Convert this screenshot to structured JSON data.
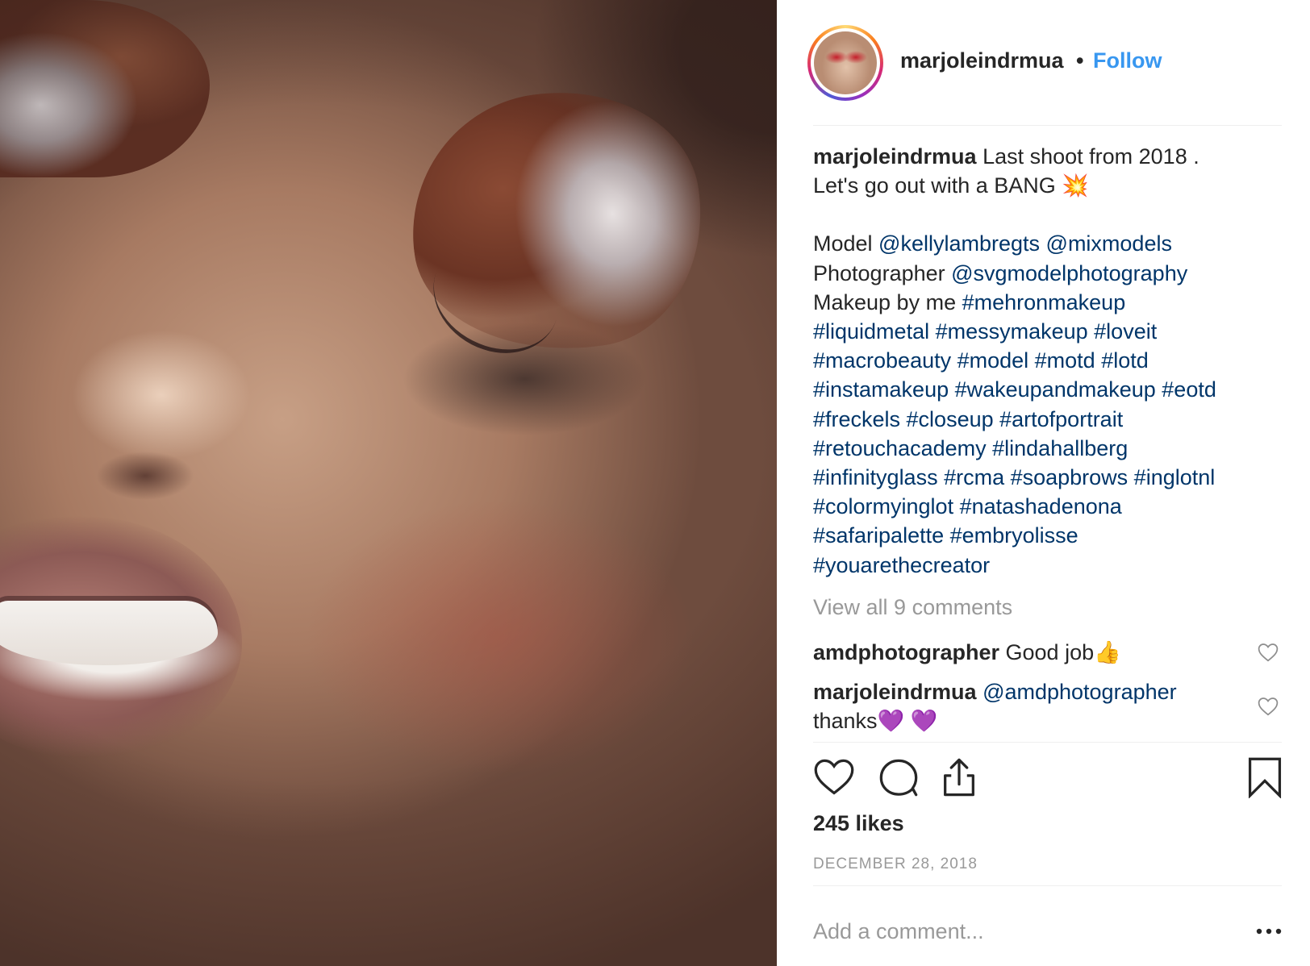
{
  "post": {
    "image_alt": "Close-up photo of a face with metallic copper and silver eyeshadow",
    "username": "marjoleindrmua",
    "separator": "•",
    "follow_label": "Follow"
  },
  "caption": {
    "username": "marjoleindrmua",
    "line1_text": " Last shoot from 2018 .",
    "line2_text": "Let's go out with a BANG 💥",
    "model_label": "Model ",
    "model_tags": [
      "@kellylambregts",
      "@mixmodels"
    ],
    "photographer_label": "Photographer ",
    "photographer_tag": "@svgmodelphotography",
    "makeup_label": "Makeup by me ",
    "makeup_tag": "#mehronmakeup",
    "hashtag_lines": [
      "#liquidmetal #messymakeup #loveit",
      "#macrobeauty #model #motd #lotd",
      "#instamakeup #wakeupandmakeup #eotd",
      "#freckels #closeup #artofportrait",
      "#retouchacademy #lindahallberg",
      "#infinityglass #rcma #soapbrows #inglotnl",
      "#colormyinglot #natashadenona",
      "#safaripalette #embryolisse",
      "#youarethecreator"
    ]
  },
  "comments": {
    "view_all": "View all 9 comments",
    "items": [
      {
        "username": "amdphotographer",
        "text": " Good job👍"
      },
      {
        "username": "marjoleindrmua",
        "mention": " @amdphotographer",
        "text2": "thanks💜 💜"
      }
    ]
  },
  "actions": {
    "like_icon": "heart-icon",
    "comment_icon": "comment-bubble-icon",
    "share_icon": "share-icon",
    "save_icon": "bookmark-icon"
  },
  "stats": {
    "likes": "245 likes",
    "date": "DECEMBER 28, 2018"
  },
  "composer": {
    "placeholder": "Add a comment...",
    "more_icon": "more-dots-icon"
  },
  "colors": {
    "link_blue": "#3897f0",
    "tag_blue": "#003569",
    "muted": "#999999",
    "text": "#262626"
  }
}
